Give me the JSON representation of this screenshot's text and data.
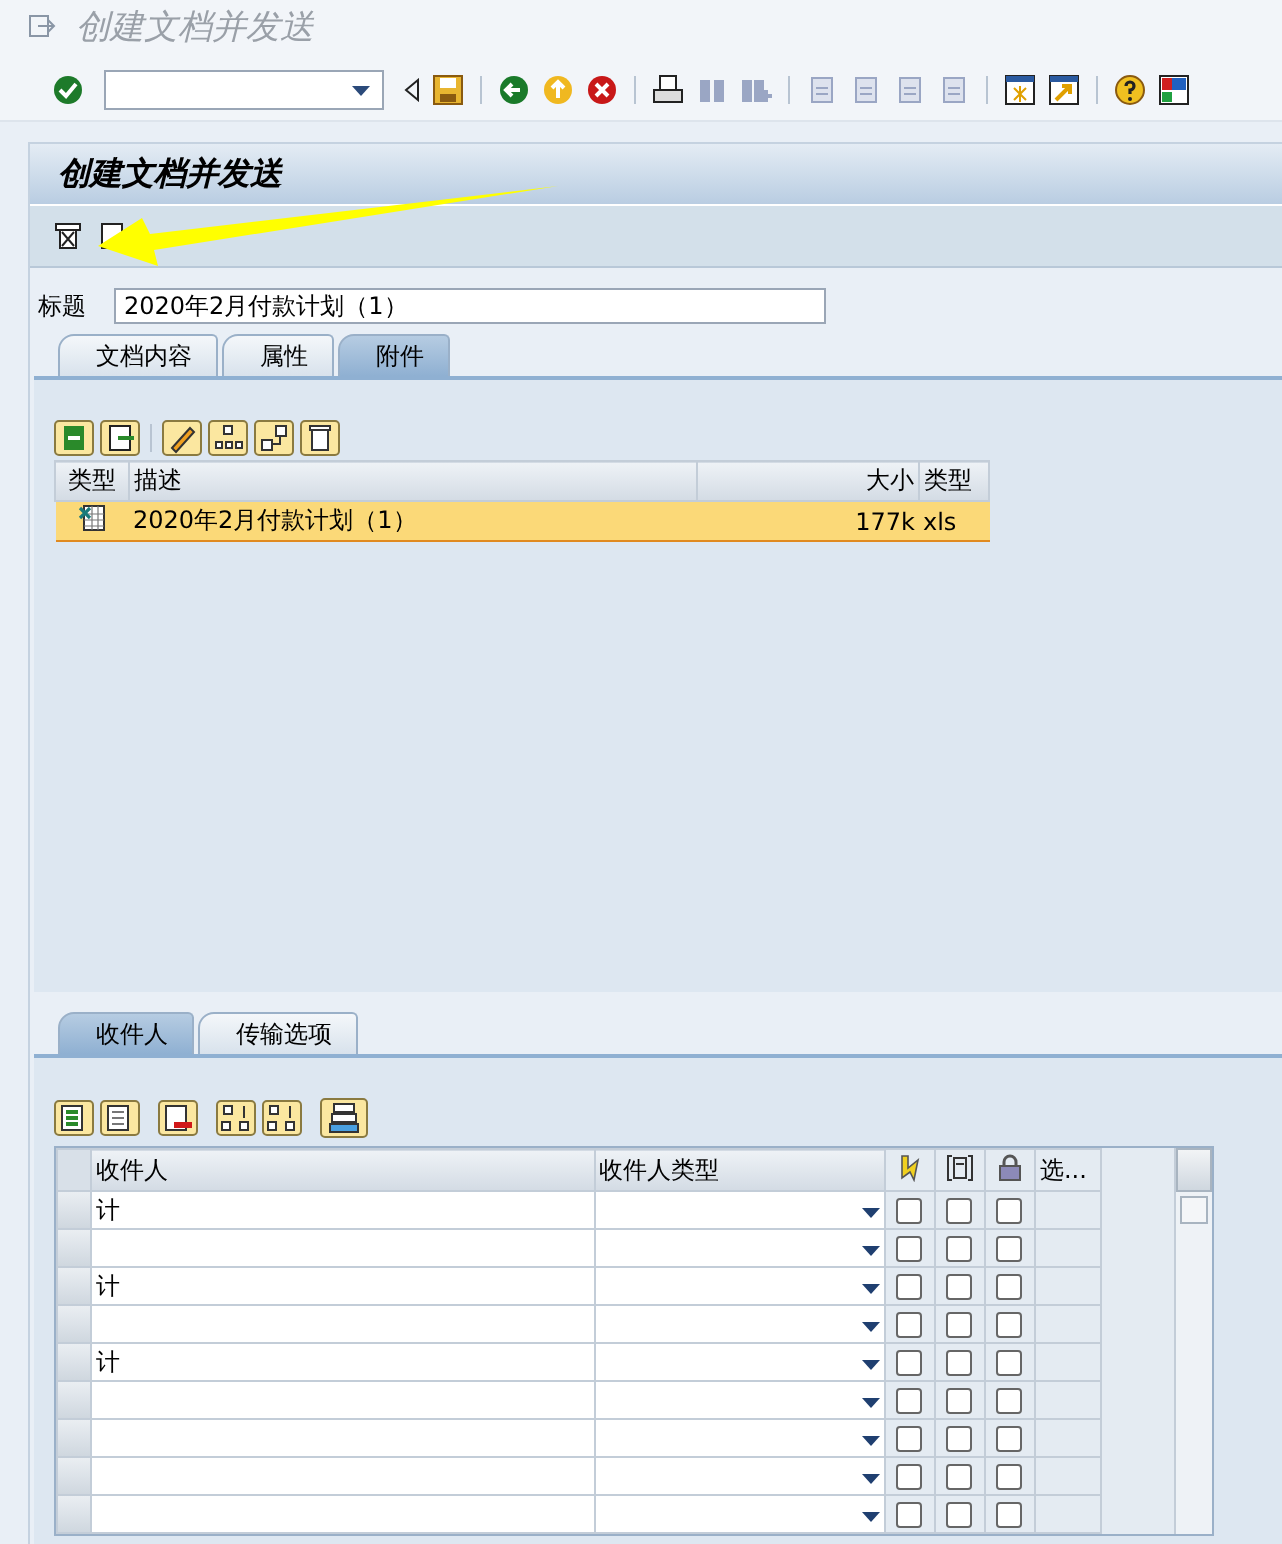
{
  "window": {
    "title": "创建文档并发送"
  },
  "screen": {
    "title": "创建文档并发送"
  },
  "subject": {
    "label": "标题",
    "value": "2020年2月付款计划（1）"
  },
  "doc_tabs": [
    {
      "label": "文档内容",
      "selected": false
    },
    {
      "label": "属性",
      "selected": false
    },
    {
      "label": "附件",
      "selected": true
    }
  ],
  "attachments": {
    "columns": [
      "类型",
      "描述",
      "大小",
      "类型"
    ],
    "rows": [
      {
        "description": "2020年2月付款计划（1）",
        "size": "177k",
        "type": "xls",
        "selected": true
      }
    ]
  },
  "recipient_tabs": [
    {
      "label": "收件人",
      "selected": true
    },
    {
      "label": "传输选项",
      "selected": false
    }
  ],
  "recipients": {
    "columns": [
      "收件人",
      "收件人类型",
      "选..."
    ],
    "rows": [
      {
        "name": "计",
        "options": [
          false,
          false,
          false
        ]
      },
      {
        "name": "",
        "options": [
          false,
          false,
          false
        ]
      },
      {
        "name": "计",
        "options": [
          false,
          false,
          false
        ]
      },
      {
        "name": "",
        "options": [
          false,
          false,
          false
        ]
      },
      {
        "name": "计",
        "options": [
          false,
          false,
          false
        ]
      },
      {
        "name": "",
        "options": [
          false,
          false,
          false
        ]
      },
      {
        "name": "",
        "options": [
          false,
          false,
          false
        ]
      },
      {
        "name": "",
        "options": [
          false,
          false,
          false
        ]
      },
      {
        "name": "",
        "options": [
          false,
          false,
          false
        ]
      }
    ]
  }
}
